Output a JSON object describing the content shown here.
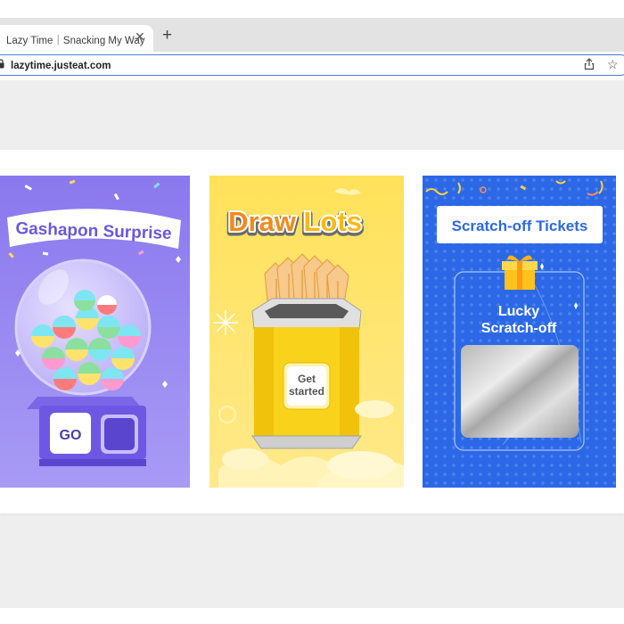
{
  "browser": {
    "tab_title": "Lazy Time｜Snacking My Way",
    "tab_close": "✕",
    "new_tab": "+",
    "url": "lazytime.justeat.com"
  },
  "cards": [
    {
      "title": "Gashapon Surprise",
      "button": "GO",
      "bg": "#8f7cf0"
    },
    {
      "title_part1": "Draw",
      "title_part2": "Lots",
      "button": "Get started",
      "button_line1": "Get",
      "button_line2": "started",
      "bg": "#fddc4c"
    },
    {
      "title": "Scratch-off Tickets",
      "subtitle_line1": "Lucky",
      "subtitle_line2": "Scratch-off",
      "bg": "#2f6ae6"
    }
  ]
}
